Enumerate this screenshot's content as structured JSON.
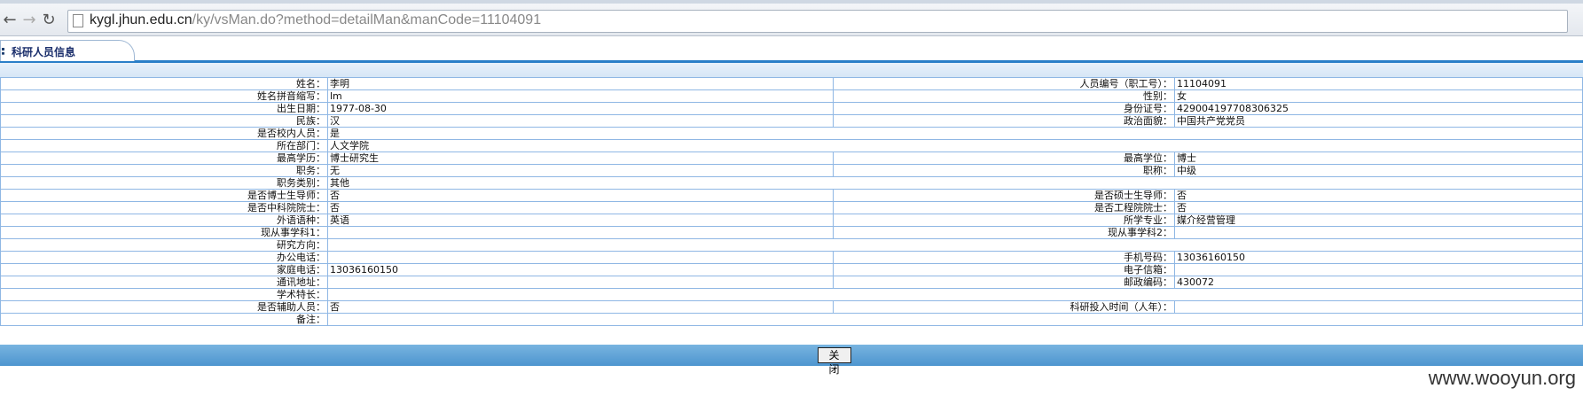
{
  "browser": {
    "url_host": "kygl.jhun.edu.cn",
    "url_path": "/ky/vsMan.do?method=detailMan&manCode=11104091"
  },
  "page": {
    "tab_label": "科研人员信息",
    "close_label": "关 闭",
    "watermark": "www.wooyun.org"
  },
  "rows": [
    {
      "l1": "姓名：",
      "v1": "李明",
      "l2": "人员编号（职工号）：",
      "v2": "11104091",
      "span": false
    },
    {
      "l1": "姓名拼音缩写：",
      "v1": "lm",
      "l2": "性别：",
      "v2": "女",
      "span": false
    },
    {
      "l1": "出生日期：",
      "v1": "1977-08-30",
      "l2": "身份证号：",
      "v2": "429004197708306325",
      "span": false
    },
    {
      "l1": "民族：",
      "v1": "汉",
      "l2": "政治面貌：",
      "v2": "中国共产党党员",
      "span": false
    },
    {
      "l1": "是否校内人员：",
      "v1": "是",
      "l2": "",
      "v2": "",
      "span": true
    },
    {
      "l1": "所在部门：",
      "v1": "人文学院",
      "l2": "",
      "v2": "",
      "span": true
    },
    {
      "l1": "最高学历：",
      "v1": "博士研究生",
      "l2": "最高学位：",
      "v2": "博士",
      "span": false
    },
    {
      "l1": "职务：",
      "v1": "无",
      "l2": "职称：",
      "v2": "中级",
      "span": false
    },
    {
      "l1": "职务类别：",
      "v1": "其他",
      "l2": "",
      "v2": "",
      "span": true
    },
    {
      "l1": "是否博士生导师：",
      "v1": "否",
      "l2": "是否硕士生导师：",
      "v2": "否",
      "span": false
    },
    {
      "l1": "是否中科院院士：",
      "v1": "否",
      "l2": "是否工程院院士：",
      "v2": "否",
      "span": false
    },
    {
      "l1": "外语语种：",
      "v1": "英语",
      "l2": "所学专业：",
      "v2": "媒介经营管理",
      "span": false
    },
    {
      "l1": "现从事学科1：",
      "v1": "",
      "l2": "现从事学科2：",
      "v2": "",
      "span": false
    },
    {
      "l1": "研究方向：",
      "v1": "",
      "l2": "",
      "v2": "",
      "span": true
    },
    {
      "l1": "办公电话：",
      "v1": "",
      "l2": "手机号码：",
      "v2": "13036160150",
      "span": false
    },
    {
      "l1": "家庭电话：",
      "v1": "13036160150",
      "l2": "电子信箱：",
      "v2": "",
      "span": false
    },
    {
      "l1": "通讯地址：",
      "v1": "",
      "l2": "邮政编码：",
      "v2": "430072",
      "span": false
    },
    {
      "l1": "学术特长：",
      "v1": "",
      "l2": "",
      "v2": "",
      "span": true
    },
    {
      "l1": "是否辅助人员：",
      "v1": "否",
      "l2": "科研投入时间（人年）：",
      "v2": "",
      "span": false
    },
    {
      "l1": "备注：",
      "v1": "",
      "l2": "",
      "v2": "",
      "span": true
    }
  ]
}
